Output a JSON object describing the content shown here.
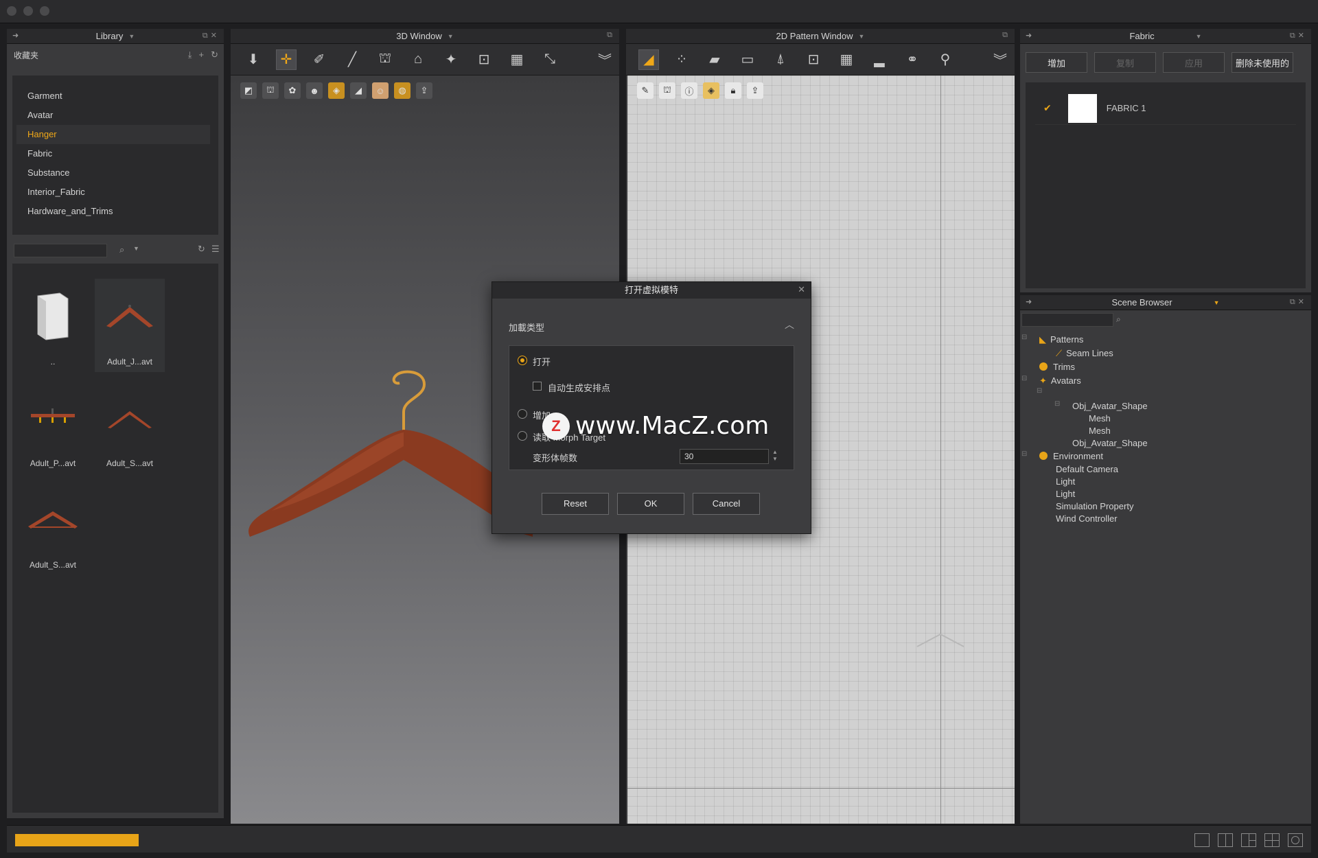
{
  "colors": {
    "accent": "#e8a418",
    "panel": "#3a3a3c",
    "dark": "#2a2a2c"
  },
  "library": {
    "title": "Library",
    "favorites_label": "收藏夹",
    "tree": [
      "Garment",
      "Avatar",
      "Hanger",
      "Fabric",
      "Substance",
      "Interior_Fabric",
      "Hardware_and_Trims"
    ],
    "active_item": "Hanger",
    "search": {
      "value": "",
      "placeholder": ""
    },
    "files": [
      {
        "name": "..",
        "icon": "folder-icon"
      },
      {
        "name": "Adult_J...avt",
        "icon": "hanger-icon",
        "selected": true
      },
      {
        "name": "Adult_P...avt",
        "icon": "pants-hanger-icon"
      },
      {
        "name": "Adult_S...avt",
        "icon": "hanger-icon"
      },
      {
        "name": "Adult_S...avt",
        "icon": "hanger-icon"
      }
    ]
  },
  "window3d": {
    "title": "3D Window"
  },
  "window2d": {
    "title": "2D Pattern Window"
  },
  "fabric": {
    "title": "Fabric",
    "buttons": {
      "add": "增加",
      "copy": "复制",
      "apply": "应用",
      "delete_unused": "删除未使用的"
    },
    "items": [
      {
        "name": "FABRIC 1",
        "color": "#ffffff"
      }
    ]
  },
  "scene": {
    "title": "Scene Browser",
    "items": {
      "patterns": "Patterns",
      "seam_lines": "Seam Lines",
      "trims": "Trims",
      "avatars": "Avatars",
      "obj_avatar_shape_1": "Obj_Avatar_Shape",
      "mesh_1": "Mesh",
      "mesh_2": "Mesh",
      "obj_avatar_shape_2": "Obj_Avatar_Shape",
      "environment": "Environment",
      "default_camera": "Default Camera",
      "light_1": "Light",
      "light_2": "Light",
      "simulation_property": "Simulation Property",
      "wind_controller": "Wind Controller"
    }
  },
  "dialog": {
    "title": "打开虚拟模特",
    "section": "加載类型",
    "option_open": "打开",
    "option_auto_points": "自动生成安排点",
    "option_add": "增加",
    "option_morph": "读取 Morph Target",
    "frames_label": "变形体帧数",
    "frames_value": "30",
    "reset": "Reset",
    "ok": "OK",
    "cancel": "Cancel"
  },
  "watermark": {
    "text": "www.MacZ.com",
    "logo": "Z"
  },
  "status": {
    "progress": 0.1
  }
}
